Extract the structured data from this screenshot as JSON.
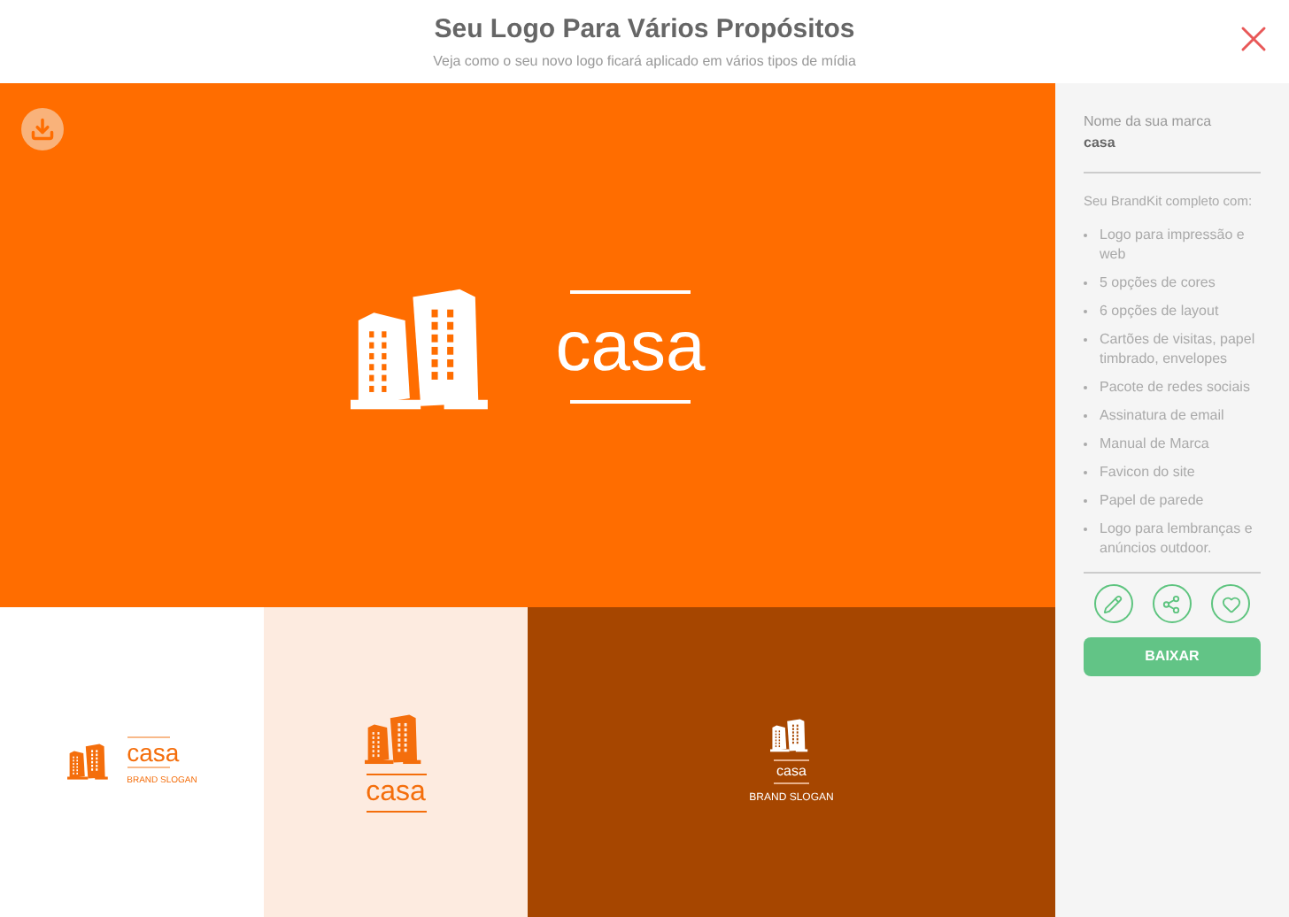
{
  "header": {
    "title": "Seu Logo Para Vários Propósitos",
    "subtitle": "Veja como o seu novo logo ficará aplicado em vários tipos de mídia"
  },
  "preview": {
    "brand": "casa"
  },
  "tiles": [
    {
      "kind": "white",
      "brand": "casa",
      "slogan": "BRAND SLOGAN"
    },
    {
      "kind": "peach",
      "brand": "casa"
    },
    {
      "kind": "brown",
      "brand": "casa",
      "slogan": "BRAND SLOGAN"
    }
  ],
  "sidebar": {
    "brand_label": "Nome da sua marca",
    "brand_name": "casa",
    "kit_label": "Seu BrandKit completo com:",
    "features": [
      "Logo para impressão e web",
      "5 opções de cores",
      "6 opções de layout",
      "Cartões de visitas, papel timbrado, envelopes",
      "Pacote de redes sociais",
      "Assinatura de email",
      "Manual de Marca",
      "Favicon do site",
      "Papel de parede",
      "Logo para lembranças e anúncios outdoor."
    ],
    "download_button": "BAIXAR"
  }
}
